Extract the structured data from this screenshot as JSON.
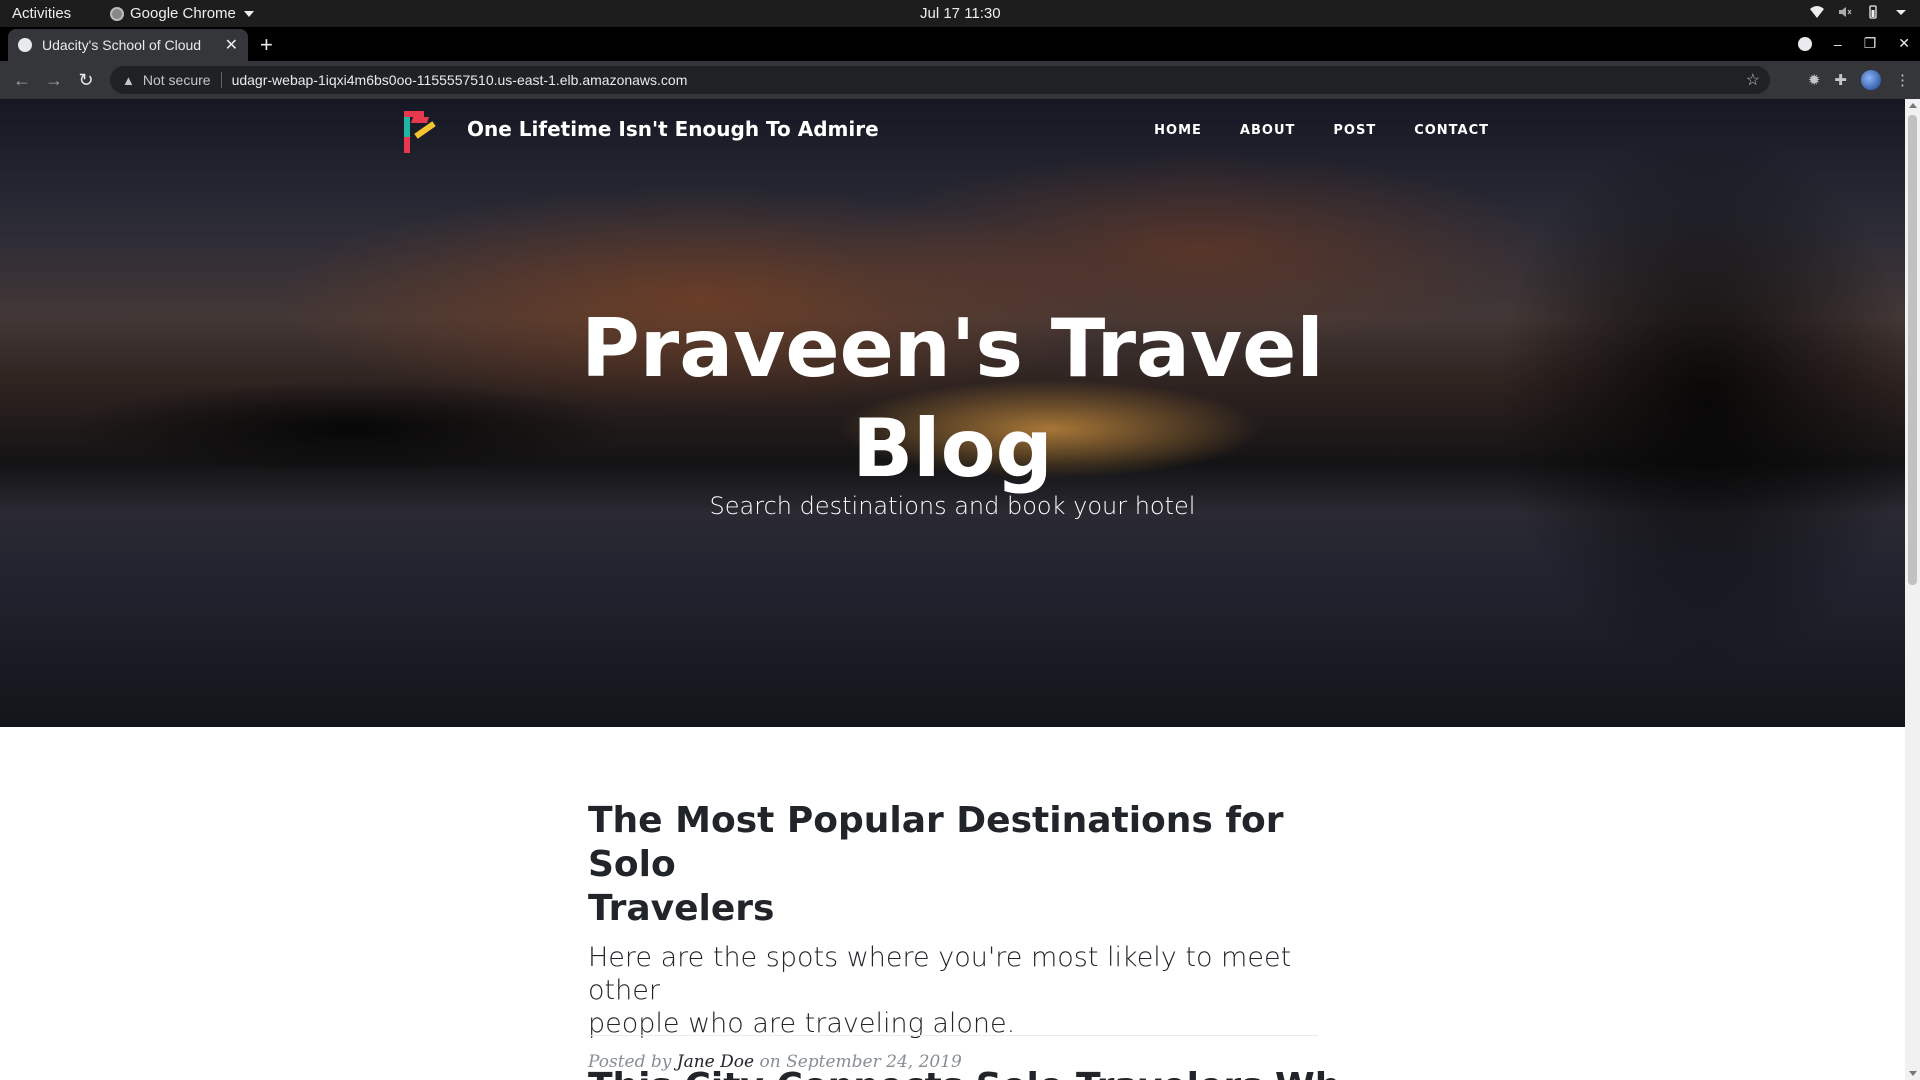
{
  "os_bar": {
    "activities": "Activities",
    "app_name": "Google Chrome",
    "datetime": "Jul 17  11:30"
  },
  "browser": {
    "tab_title": "Udacity's School of Cloud",
    "security_label": "Not secure",
    "url": "udagr-webap-1iqxi4m6bs0oo-1155557510.us-east-1.elb.amazonaws.com"
  },
  "site": {
    "brand": "One Lifetime Isn't Enough To Admire",
    "nav": [
      "HOME",
      "ABOUT",
      "POST",
      "CONTACT"
    ],
    "hero_title_line1": "Praveen's Travel",
    "hero_title_line2": "Blog",
    "hero_subtitle": "Search destinations and book your hotel"
  },
  "posts": [
    {
      "title_line1": "The Most Popular Destinations for Solo",
      "title_line2": "Travelers",
      "subtitle_line1": "Here are the spots where you're most likely to meet other",
      "subtitle_line2": "people who are traveling alone.",
      "meta_prefix": "Posted by",
      "author": "Jane Doe",
      "meta_on": "on",
      "date": "September 24, 2019"
    },
    {
      "title": "This City Connects Solo Travelers Wh"
    }
  ]
}
